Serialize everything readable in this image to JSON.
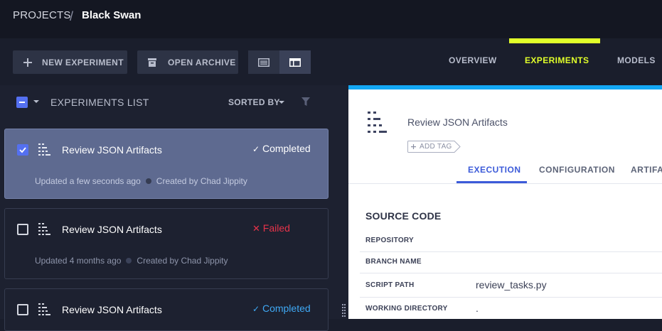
{
  "breadcrumb": {
    "root": "PROJECTS",
    "separator": "/",
    "project": "Black Swan"
  },
  "toolbar": {
    "new_experiment": "NEW EXPERIMENT",
    "open_archive": "OPEN ARCHIVE"
  },
  "nav_tabs": {
    "overview": "OVERVIEW",
    "experiments": "EXPERIMENTS",
    "models": "MODELS",
    "active": "experiments"
  },
  "list": {
    "title": "EXPERIMENTS LIST",
    "sorted_by": "SORTED BY",
    "items": [
      {
        "title": "Review JSON Artifacts",
        "status": "Completed",
        "status_glyph": "✓",
        "updated": "Updated a few seconds ago",
        "created": "Created by Chad Jippity",
        "selected": true
      },
      {
        "title": "Review JSON Artifacts",
        "status": "Failed",
        "status_glyph": "✕",
        "updated": "Updated 4 months ago",
        "created": "Created by Chad Jippity",
        "selected": false
      },
      {
        "title": "Review JSON Artifacts",
        "status": "Completed",
        "status_glyph": "✓",
        "selected": false
      }
    ]
  },
  "details": {
    "title": "Review JSON Artifacts",
    "add_tag": "ADD TAG",
    "tabs": {
      "execution": "EXECUTION",
      "configuration": "CONFIGURATION",
      "artifacts": "ARTIFAC"
    },
    "section_title": "SOURCE CODE",
    "fields": {
      "repository": {
        "label": "REPOSITORY",
        "value": ""
      },
      "branch": {
        "label": "BRANCH NAME",
        "value": ""
      },
      "script_path": {
        "label": "SCRIPT PATH",
        "value": "review_tasks.py"
      },
      "working_dir": {
        "label": "WORKING DIRECTORY",
        "value": "."
      }
    }
  },
  "colors": {
    "accent_lime": "#e1ff2a",
    "accent_blue": "#5470f0",
    "tab_blue": "#3c5bd9",
    "completed_white": "#ffffff",
    "completed_blue": "#3fa9f5",
    "failed_red": "#e6334a",
    "right_top_border": "#13a8f5"
  },
  "icons": [
    "plus-icon",
    "archive-icon",
    "table-view-icon",
    "details-view-icon",
    "caret-down-icon",
    "filter-icon",
    "experiment-icon",
    "checkmark-icon",
    "x-icon",
    "tag-icon",
    "drag-grip-icon"
  ]
}
